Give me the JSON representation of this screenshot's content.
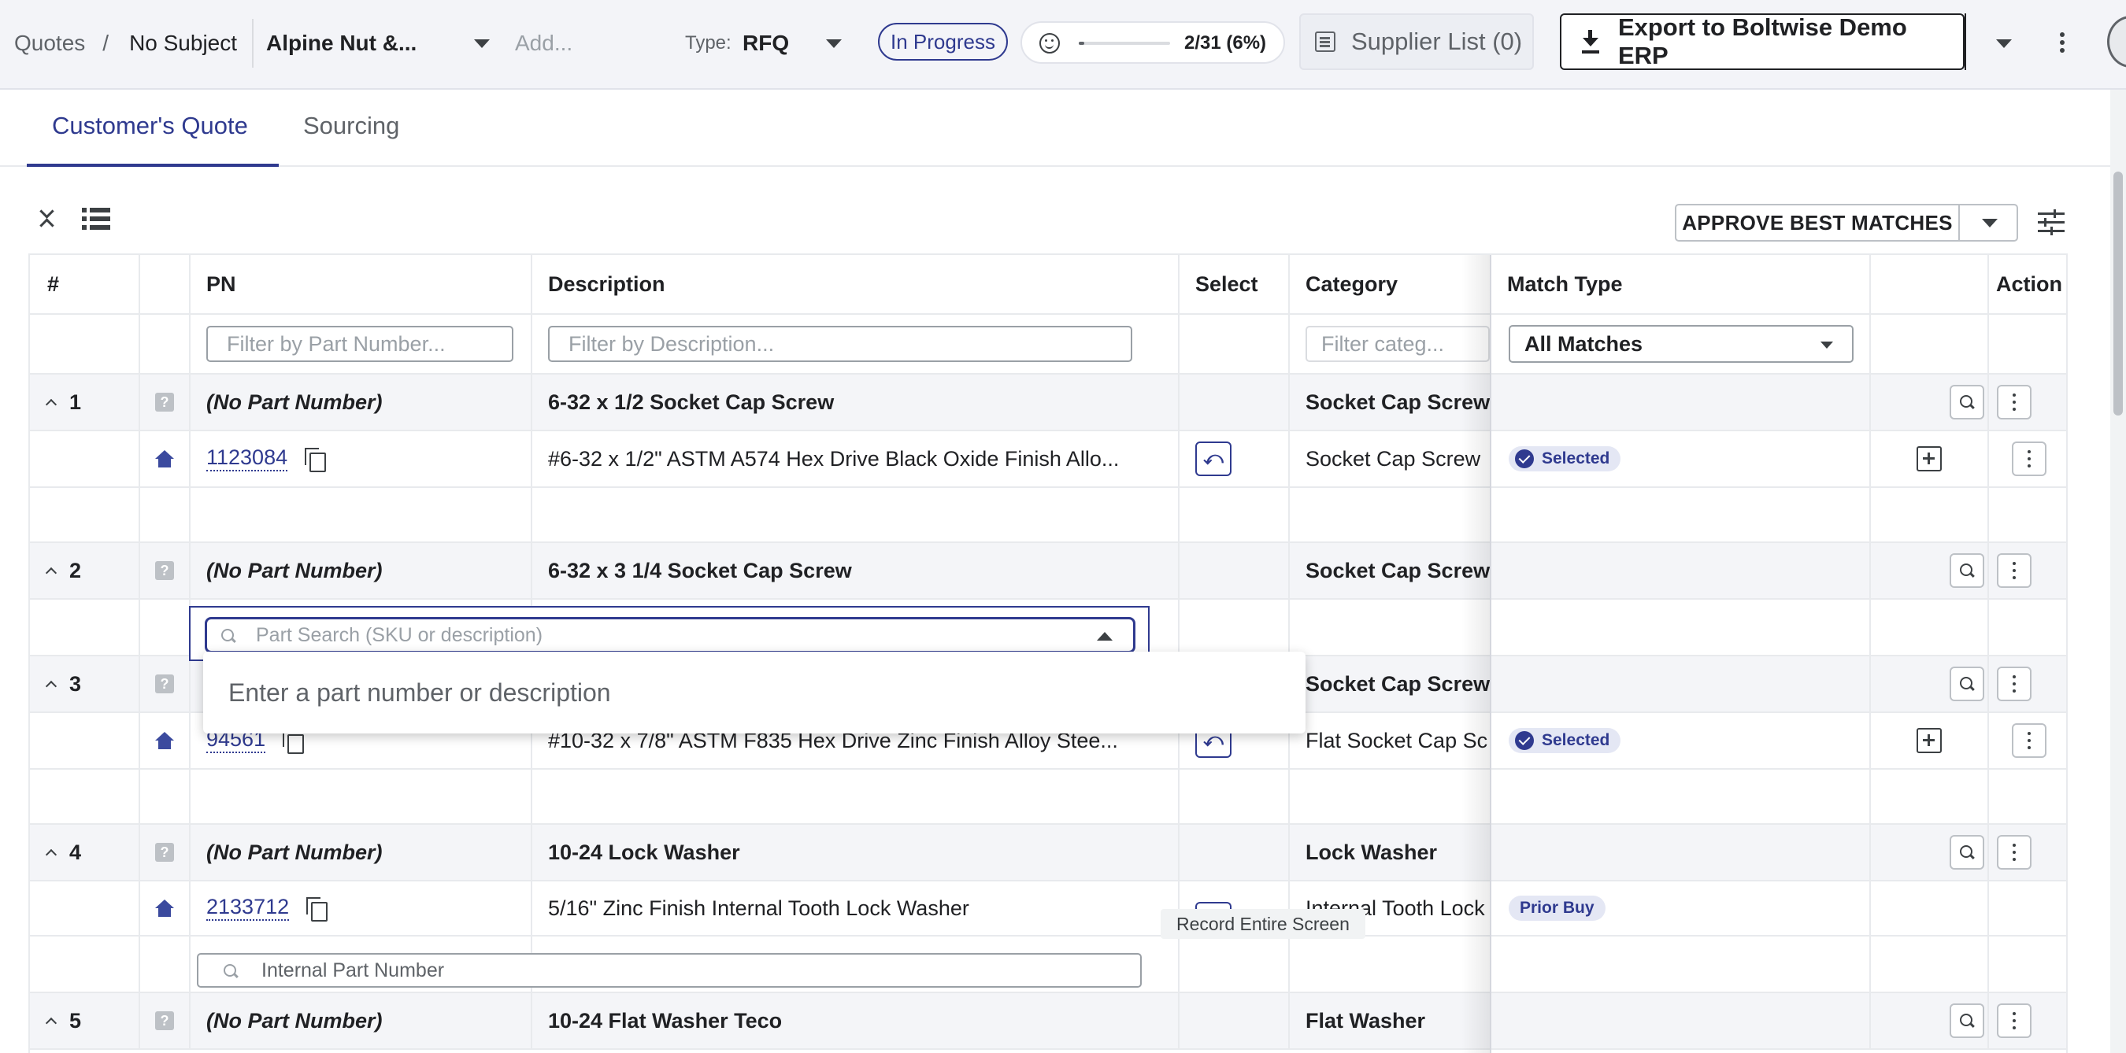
{
  "header": {
    "breadcrumb_root": "Quotes",
    "breadcrumb_sep": "/",
    "breadcrumb_current": "No Subject",
    "customer": "Alpine Nut &...",
    "add_placeholder": "Add...",
    "type_label": "Type:",
    "type_value": "RFQ",
    "status": "In Progress",
    "progress_text": "2/31 (6%)",
    "progress_fraction": 0.06,
    "supplier_list": "Supplier List (0)",
    "export_label": "Export to Boltwise Demo ERP"
  },
  "tabs": [
    {
      "label": "Customer's Quote",
      "active": true
    },
    {
      "label": "Sourcing",
      "active": false
    }
  ],
  "toolbar": {
    "approve_label": "APPROVE BEST MATCHES"
  },
  "table": {
    "columns": {
      "num": "#",
      "pn": "PN",
      "description": "Description",
      "select": "Select",
      "category": "Category",
      "match_type": "Match Type",
      "action": "Action"
    },
    "filters": {
      "pn_placeholder": "Filter by Part Number...",
      "desc_placeholder": "Filter by Description...",
      "category_placeholder": "Filter categ...",
      "match_value": "All Matches"
    },
    "groups": [
      {
        "num": "1",
        "pn": "(No Part Number)",
        "description": "6-32 x 1/2 Socket Cap Screw",
        "category": "Socket Cap Screw",
        "match": {
          "pn": "1123084",
          "description": "#6-32 x 1/2\" ASTM A574 Hex Drive Black Oxide Finish Allo...",
          "category": "Socket Cap Screw",
          "badge": "Selected"
        }
      },
      {
        "num": "2",
        "pn": "(No Part Number)",
        "description": "6-32 x 3 1/4 Socket Cap Screw",
        "category": "Socket Cap Screw"
      },
      {
        "num": "3",
        "category": "Socket Cap Screw",
        "match": {
          "pn": "94561",
          "description": "#10-32 x 7/8\" ASTM F835 Hex Drive Zinc Finish Alloy Stee...",
          "category": "Flat Socket Cap Sc",
          "badge": "Selected"
        }
      },
      {
        "num": "4",
        "pn": "(No Part Number)",
        "description": "10-24 Lock Washer",
        "category": "Lock Washer",
        "match": {
          "pn": "2133712",
          "description": "5/16\" Zinc Finish Internal Tooth Lock Washer",
          "category": "Internal Tooth Lock",
          "badge": "Prior Buy"
        }
      },
      {
        "num": "5",
        "pn": "(No Part Number)",
        "description": "10-24 Flat Washer Teco",
        "category": "Flat Washer"
      }
    ]
  },
  "search": {
    "placeholder": "Part Search (SKU or description)",
    "empty_hint": "Enter a part number or description"
  },
  "internal_pn_placeholder": "Internal Part Number",
  "tooltip": "Record Entire Screen",
  "colors": {
    "accent": "#2f3a8f",
    "badge_bg": "#e4e7f4",
    "group_row_bg": "#f4f5f8"
  }
}
